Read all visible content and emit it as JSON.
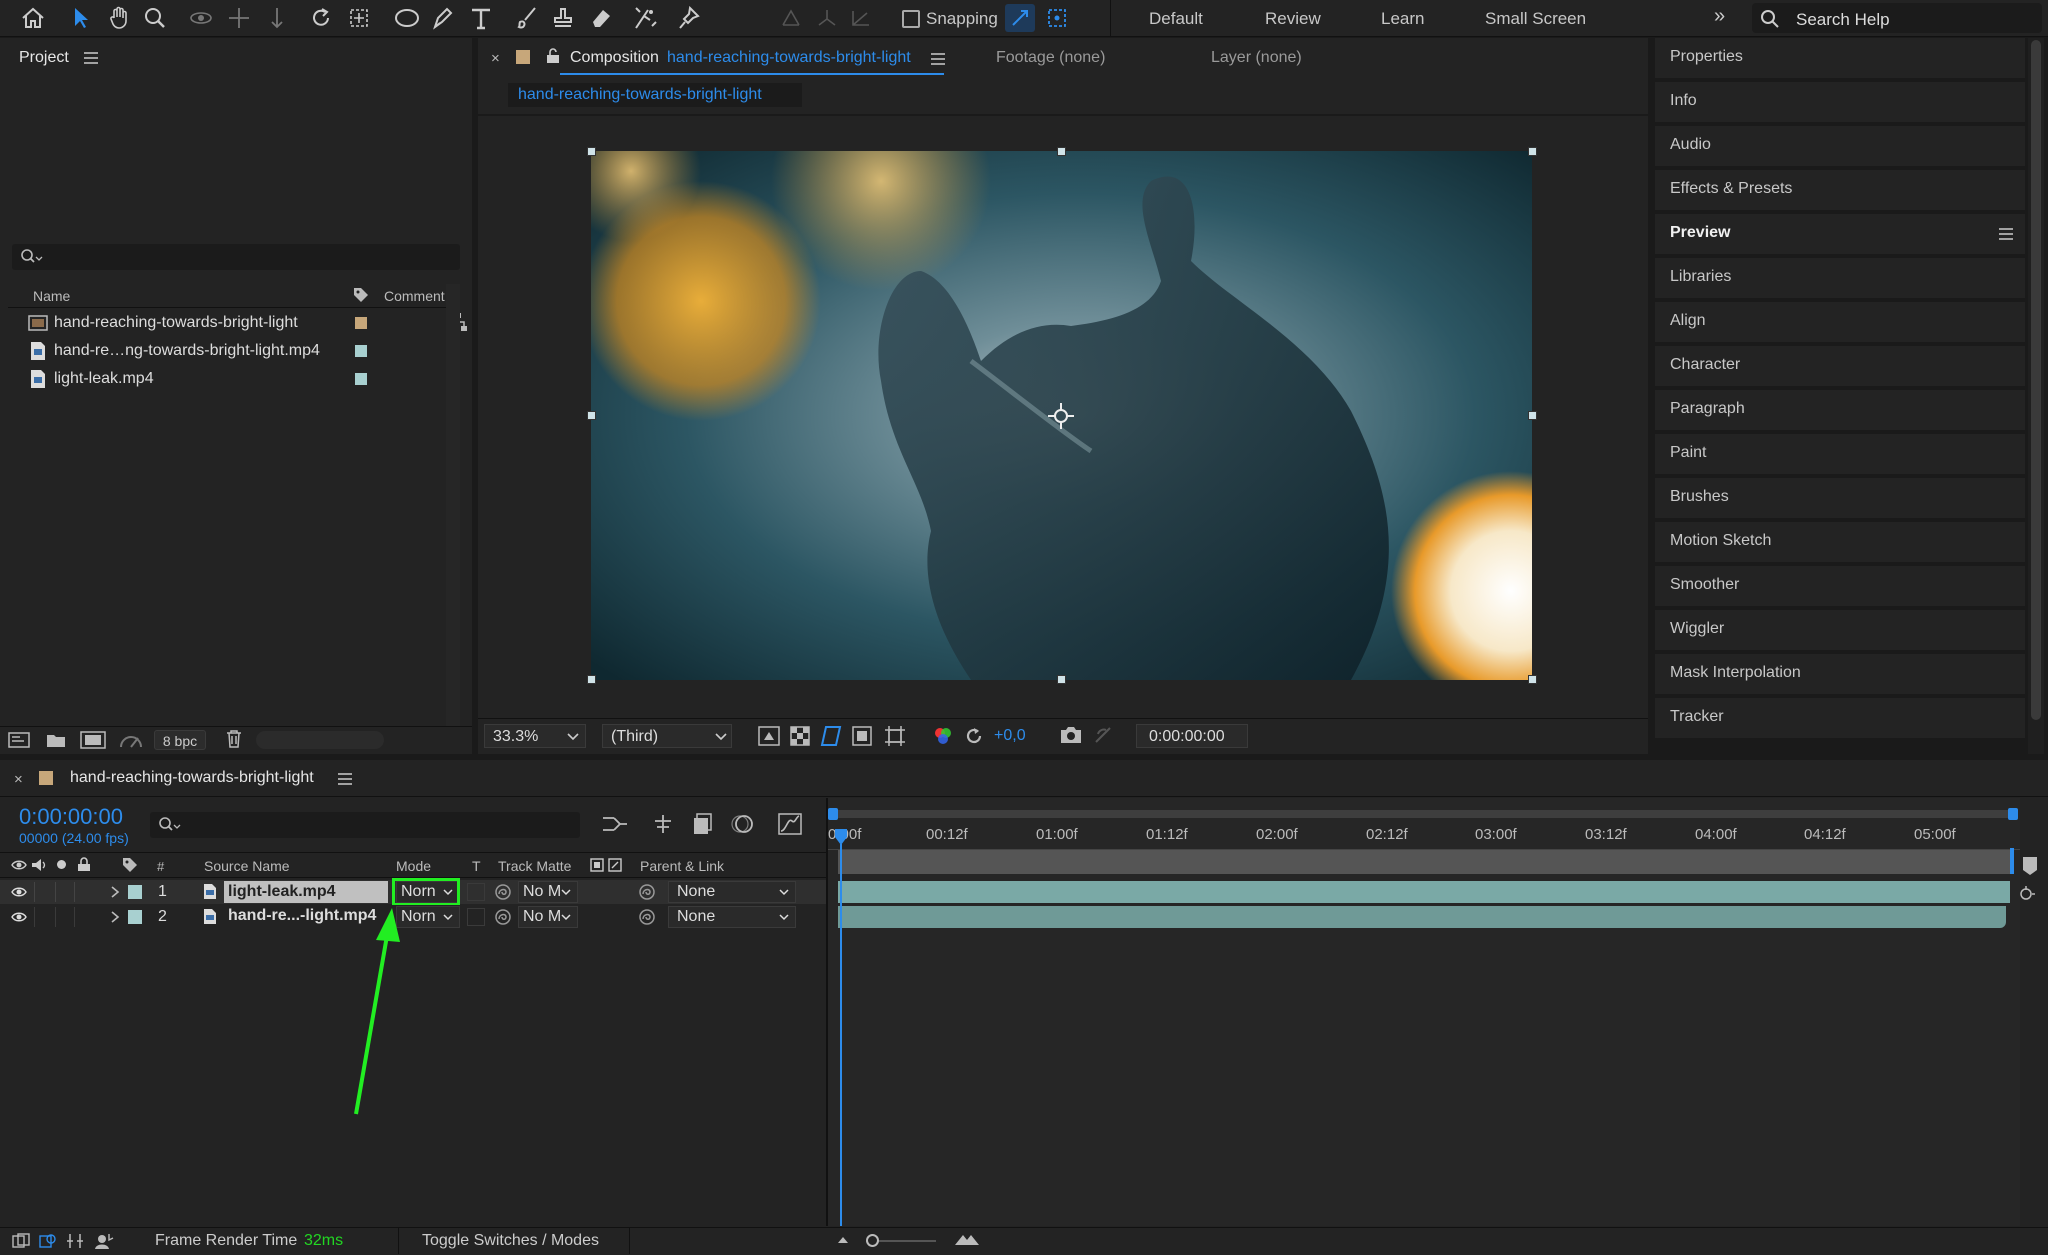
{
  "toolbar": {
    "snapping_label": "Snapping",
    "workspaces": [
      "Default",
      "Review",
      "Learn",
      "Small Screen"
    ],
    "search_placeholder": "Search Help"
  },
  "project": {
    "title": "Project",
    "col_name": "Name",
    "col_comment": "Comment",
    "items": [
      {
        "name": "hand-reaching-towards-bright-light",
        "type": "composition",
        "label_color": "#c7a77a"
      },
      {
        "name": "hand-re…ng-towards-bright-light.mp4",
        "type": "footage",
        "label_color": "#a8d0d0"
      },
      {
        "name": "light-leak.mp4",
        "type": "footage",
        "label_color": "#a8d0d0"
      }
    ],
    "bpc": "8 bpc"
  },
  "viewer": {
    "tab_comp_prefix": "Composition",
    "tab_comp_name": "hand-reaching-towards-bright-light",
    "tab_footage": "Footage (none)",
    "tab_layer": "Layer (none)",
    "breadcrumb": "hand-reaching-towards-bright-light",
    "zoom": "33.3%",
    "resolution": "(Third)",
    "exposure": "+0,0",
    "timecode": "0:00:00:00"
  },
  "right_panels": {
    "items": [
      "Properties",
      "Info",
      "Audio",
      "Effects & Presets",
      "Preview",
      "Libraries",
      "Align",
      "Character",
      "Paragraph",
      "Paint",
      "Brushes",
      "Motion Sketch",
      "Smoother",
      "Wiggler",
      "Mask Interpolation",
      "Tracker"
    ],
    "active": "Preview"
  },
  "timeline": {
    "comp_name": "hand-reaching-towards-bright-light",
    "current_time": "0:00:00:00",
    "frame_info": "00000 (24.00 fps)",
    "headers": {
      "num": "#",
      "source_name": "Source Name",
      "mode": "Mode",
      "t": "T",
      "track_matte": "Track Matte",
      "parent": "Parent & Link"
    },
    "layers": [
      {
        "num": "1",
        "name": "light-leak.mp4",
        "mode": "Norn",
        "matte": "No M",
        "parent": "None",
        "selected": true
      },
      {
        "num": "2",
        "name": "hand-re...-light.mp4",
        "mode": "Norn",
        "matte": "No M",
        "parent": "None",
        "selected": false
      }
    ],
    "ruler": [
      "0:00f",
      "00:12f",
      "01:00f",
      "01:12f",
      "02:00f",
      "02:12f",
      "03:00f",
      "03:12f",
      "04:00f",
      "04:12f",
      "05:00f"
    ],
    "frame_render_label": "Frame Render Time",
    "frame_render_value": "32ms",
    "toggle_label": "Toggle Switches / Modes"
  },
  "colors": {
    "accent": "#2d8ceb",
    "highlight": "#22ee22",
    "layer_bar": "#7aa9a6"
  }
}
